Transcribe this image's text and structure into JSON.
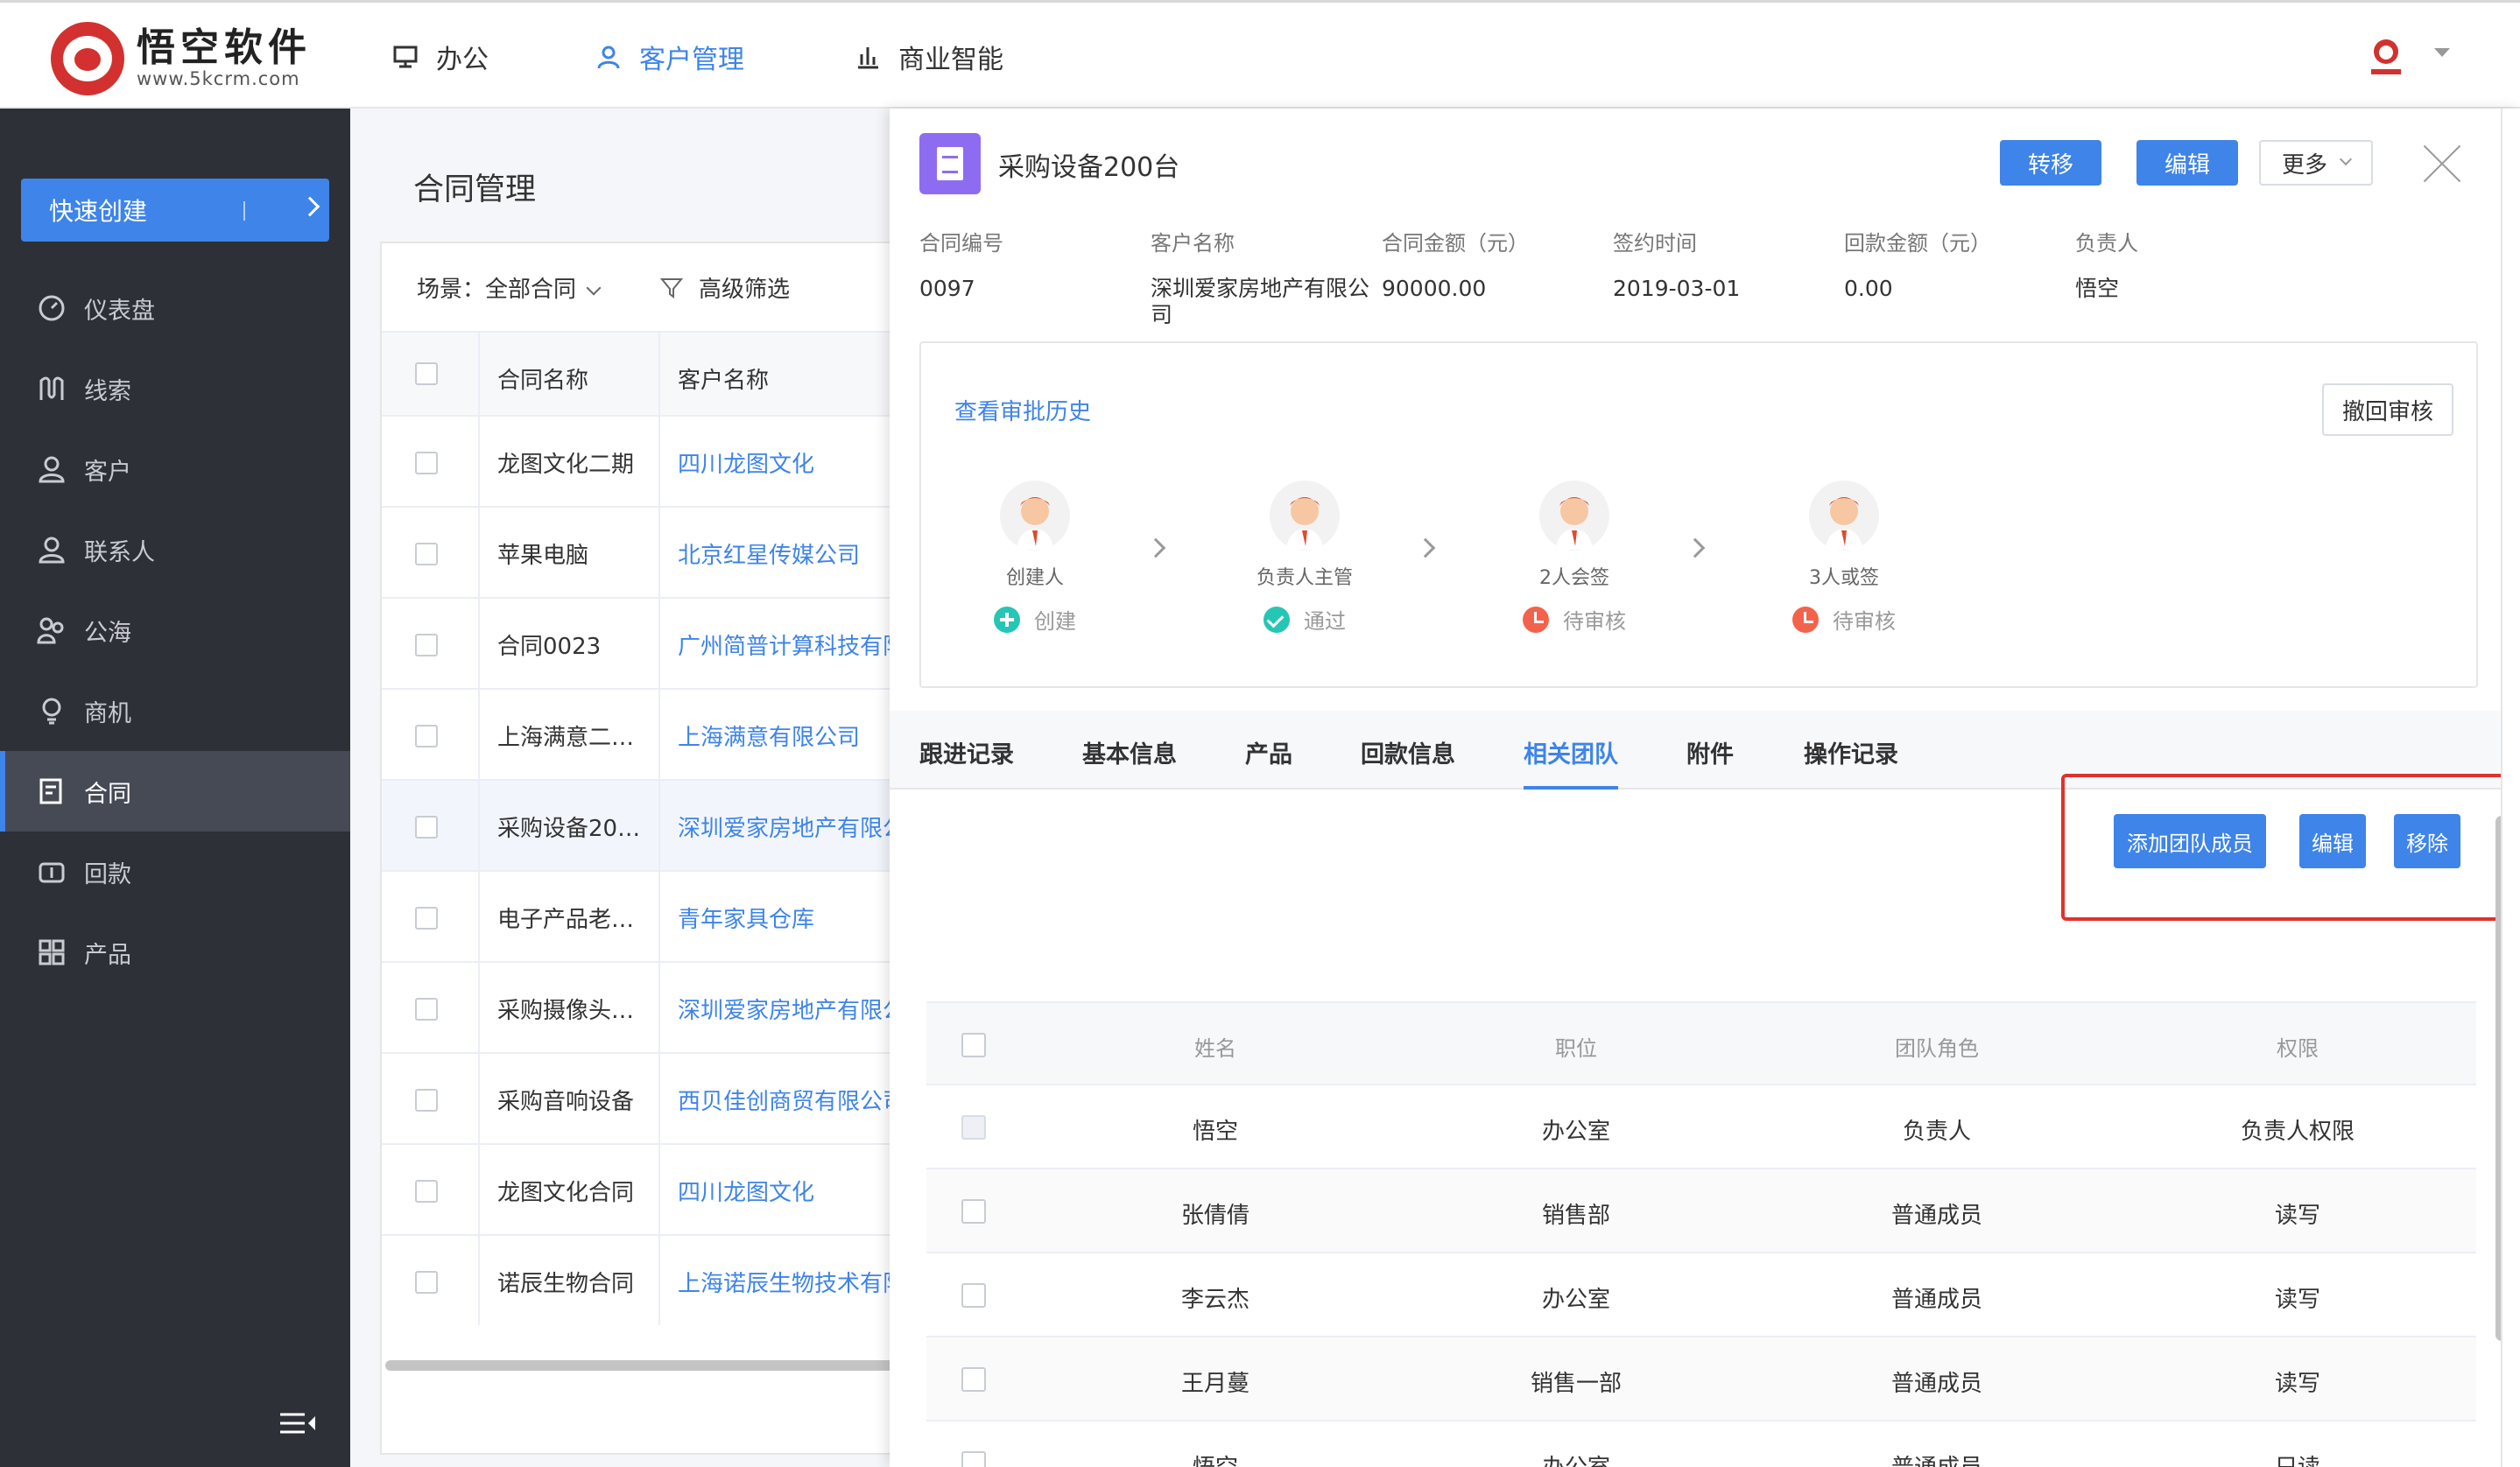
{
  "brand": {
    "name": "悟空软件",
    "url": "www.5kcrm.com"
  },
  "topnav": [
    {
      "label": "办公",
      "icon": "monitor-icon"
    },
    {
      "label": "客户管理",
      "icon": "user-icon"
    },
    {
      "label": "商业智能",
      "icon": "bar-chart-icon"
    }
  ],
  "sidebar": {
    "quick_create": "快速创建",
    "items": [
      {
        "label": "仪表盘",
        "icon": "dashboard-icon"
      },
      {
        "label": "线索",
        "icon": "lead-icon"
      },
      {
        "label": "客户",
        "icon": "customer-icon"
      },
      {
        "label": "联系人",
        "icon": "contact-icon"
      },
      {
        "label": "公海",
        "icon": "pool-icon"
      },
      {
        "label": "商机",
        "icon": "bulb-icon"
      },
      {
        "label": "合同",
        "icon": "contract-icon"
      },
      {
        "label": "回款",
        "icon": "payment-icon"
      },
      {
        "label": "产品",
        "icon": "product-icon"
      }
    ],
    "active": "合同"
  },
  "list": {
    "title": "合同管理",
    "scene_label": "场景：全部合同",
    "advanced_filter": "高级筛选",
    "columns": [
      "合同名称",
      "客户名称"
    ],
    "rows": [
      {
        "name": "龙图文化二期",
        "customer": "四川龙图文化"
      },
      {
        "name": "苹果电脑",
        "customer": "北京红星传媒公司"
      },
      {
        "name": "合同0023",
        "customer": "广州简普计算科技有限公司"
      },
      {
        "name": "上海满意二…",
        "customer": "上海满意有限公司"
      },
      {
        "name": "采购设备20…",
        "customer": "深圳爱家房地产有限公司"
      },
      {
        "name": "电子产品老…",
        "customer": "青年家具仓库"
      },
      {
        "name": "采购摄像头…",
        "customer": "深圳爱家房地产有限公司"
      },
      {
        "name": "采购音响设备",
        "customer": "西贝佳创商贸有限公司"
      },
      {
        "name": "龙图文化合同",
        "customer": "四川龙图文化"
      },
      {
        "name": "诺辰生物合同",
        "customer": "上海诺辰生物技术有限公司"
      }
    ]
  },
  "detail": {
    "title": "采购设备200台",
    "buttons": {
      "transfer": "转移",
      "edit": "编辑",
      "more": "更多"
    },
    "meta": [
      {
        "label": "合同编号",
        "value": "0097"
      },
      {
        "label": "客户名称",
        "value": "深圳爱家房地产有限公司"
      },
      {
        "label": "合同金额（元）",
        "value": "90000.00"
      },
      {
        "label": "签约时间",
        "value": "2019-03-01"
      },
      {
        "label": "回款金额（元）",
        "value": "0.00"
      },
      {
        "label": "负责人",
        "value": "悟空"
      }
    ],
    "approval": {
      "history_link": "查看审批历史",
      "revoke": "撤回审核",
      "steps": [
        {
          "name": "创建人",
          "status": "创建"
        },
        {
          "name": "负责人主管",
          "status": "通过"
        },
        {
          "name": "2人会签",
          "status": "待审核"
        },
        {
          "name": "3人或签",
          "status": "待审核"
        }
      ]
    },
    "tabs": [
      "跟进记录",
      "基本信息",
      "产品",
      "回款信息",
      "相关团队",
      "附件",
      "操作记录"
    ],
    "active_tab": "相关团队",
    "team_actions": {
      "add": "添加团队成员",
      "edit": "编辑",
      "remove": "移除"
    },
    "team": {
      "columns": [
        "姓名",
        "职位",
        "团队角色",
        "权限"
      ],
      "rows": [
        {
          "name": "悟空",
          "position": "办公室",
          "role": "负责人",
          "permission": "负责人权限"
        },
        {
          "name": "张倩倩",
          "position": "销售部",
          "role": "普通成员",
          "permission": "读写"
        },
        {
          "name": "李云杰",
          "position": "办公室",
          "role": "普通成员",
          "permission": "读写"
        },
        {
          "name": "王月蔓",
          "position": "销售一部",
          "role": "普通成员",
          "permission": "读写"
        },
        {
          "name": "悟空",
          "position": "办公室",
          "role": "普通成员",
          "permission": "只读"
        }
      ]
    }
  },
  "colors": {
    "primary": "#3e84e9",
    "sidebar": "#2d3037",
    "highlight_box": "#e0312c"
  }
}
